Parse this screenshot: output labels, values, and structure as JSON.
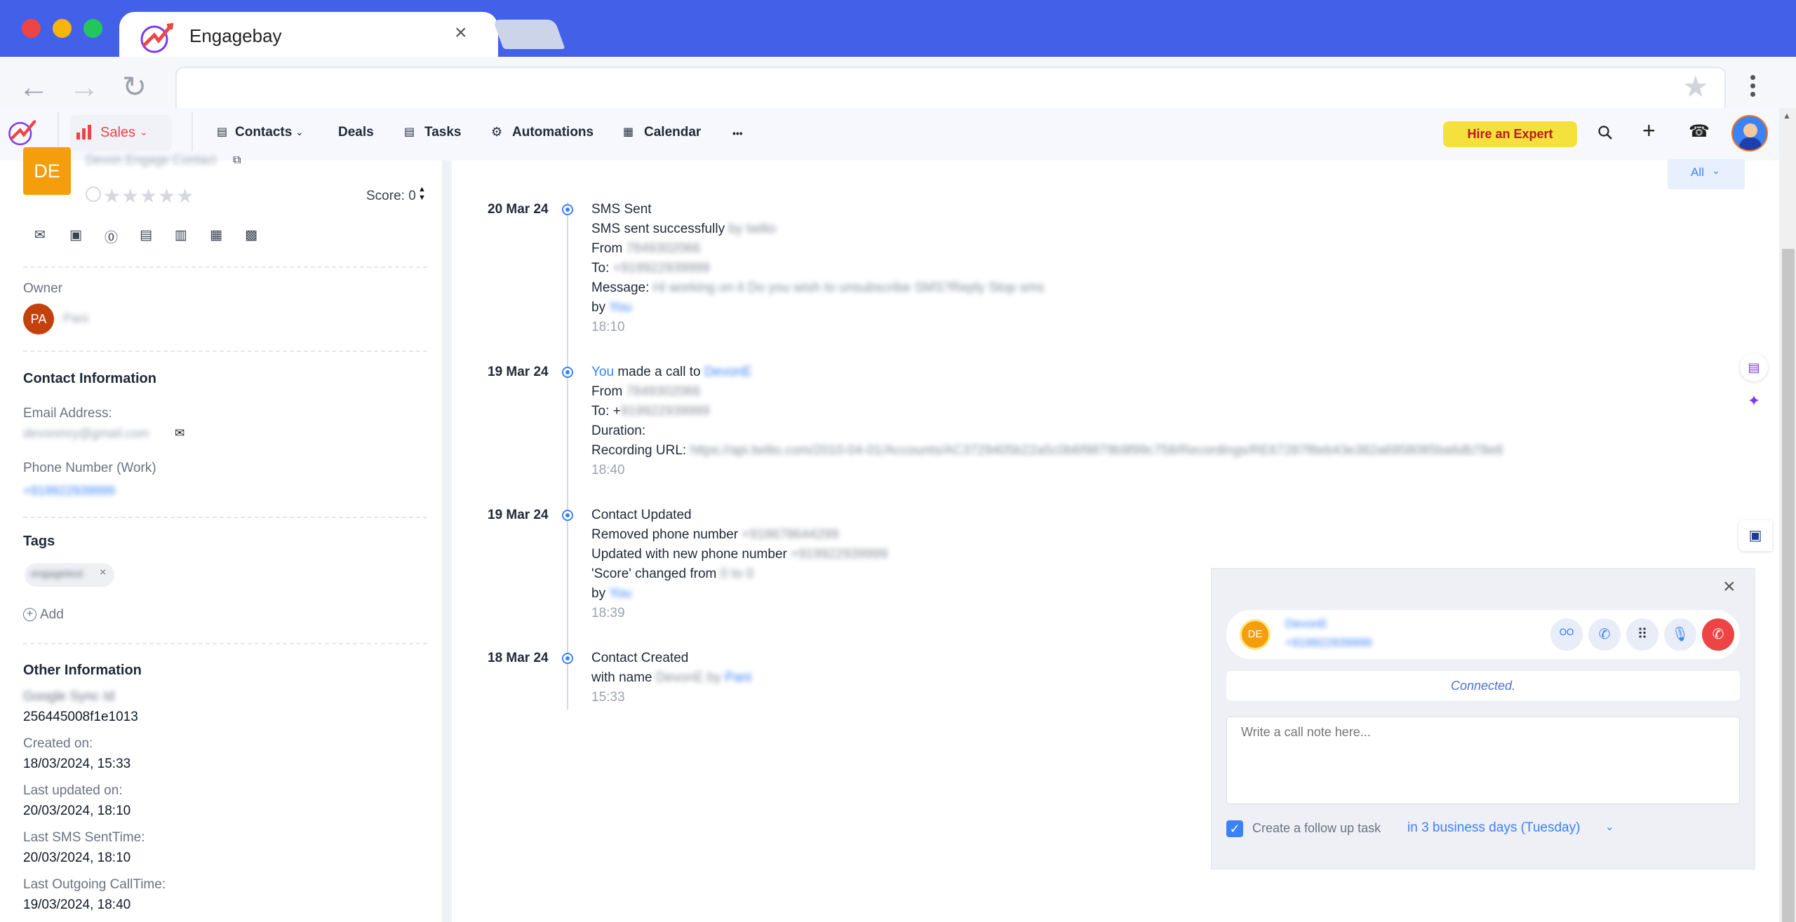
{
  "browser": {
    "tab_title": "Engagebay",
    "tab_close": "×",
    "url": ""
  },
  "nav": {
    "sales": "Sales",
    "contacts": "Contacts",
    "deals": "Deals",
    "tasks": "Tasks",
    "automations": "Automations",
    "calendar": "Calendar",
    "more": "•••",
    "hire_expert": "Hire an Expert"
  },
  "contact": {
    "initials": "DE",
    "name_blurred": "Devon Engage Contact",
    "score_label": "Score: 0",
    "owner_label": "Owner",
    "owner_initials": "PA",
    "owner_name": "Pani",
    "contact_info_header": "Contact Information",
    "email_label": "Email Address:",
    "email_value": "devonmry@gmail.com",
    "phone_label": "Phone Number (Work)",
    "phone_value": "+919922939999",
    "tags_header": "Tags",
    "tag_value": "engagetest",
    "tag_remove": "×",
    "add_tag": "Add",
    "other_info_header": "Other Information",
    "google_sync_label": "Google Sync Id",
    "google_sync_value": "256445008f1e1013",
    "created_label": "Created on:",
    "created_value": "18/03/2024, 15:33",
    "updated_label": "Last updated on:",
    "updated_value": "20/03/2024, 18:10",
    "sms_label": "Last SMS SentTime:",
    "sms_value": "20/03/2024, 18:10",
    "call_label": "Last Outgoing CallTime:",
    "call_value": "19/03/2024, 18:40"
  },
  "filter": {
    "label": "All"
  },
  "timeline": {
    "e1": {
      "date": "20 Mar 24",
      "title": "SMS Sent",
      "l2a": "SMS sent successfully",
      "l2b": "by twilio",
      "from_label": "From",
      "from_value": "7849302066",
      "to_label": "To:",
      "to_value": "+919922939999",
      "msg_label": "Message:",
      "msg_value": "Hi working on it Do you wish to unsubscribe SMS?Reply Stop sms",
      "by_label": "by",
      "by_value": "You",
      "time": "18:10"
    },
    "e2": {
      "date": "19 Mar 24",
      "you": "You",
      "made_call": " made a call to",
      "call_target": "DevonE",
      "from_label": "From",
      "from_value": "7849302066",
      "to_label": "To: +",
      "to_value": "919922939999",
      "duration_label": "Duration:",
      "recording_label": "Recording URL:",
      "recording_value": "https://api.twilio.com/2010-04-01/Accounts/AC3729405b22a5c0b6f9879b9f99c758/Recordings/RE67287f8eb43e382a6958085ba6db78e8",
      "time": "18:40"
    },
    "e3": {
      "date": "19 Mar 24",
      "title": "Contact Updated",
      "removed_label": "Removed phone number",
      "removed_value": "+918678644299",
      "updated_label": "Updated with new phone number",
      "updated_value": "+919922939999",
      "score_label": "'Score' changed from",
      "score_value": "0 to 0",
      "by_label": "by",
      "by_value": "You",
      "time": "18:39"
    },
    "e4": {
      "date": "18 Mar 24",
      "title": "Contact Created",
      "with_name": "with name",
      "name_value": "DevonE by",
      "by_value": "Pani",
      "time": "15:33"
    }
  },
  "call_widget": {
    "close": "×",
    "initials": "DE",
    "name": "DevonE",
    "number": "+919922939999",
    "status": "Connected.",
    "note_placeholder": "Write a call note here...",
    "followup_label": "Create a follow up task",
    "followup_value": "in 3 business days (Tuesday)"
  },
  "colors": {
    "titlebar": "#4361e8",
    "accent_blue": "#3b82f6",
    "sales_red": "#ef4444",
    "hire_bg": "#f5e13b",
    "avatar_orange": "#f59e0b",
    "hangup": "#ef4444"
  }
}
